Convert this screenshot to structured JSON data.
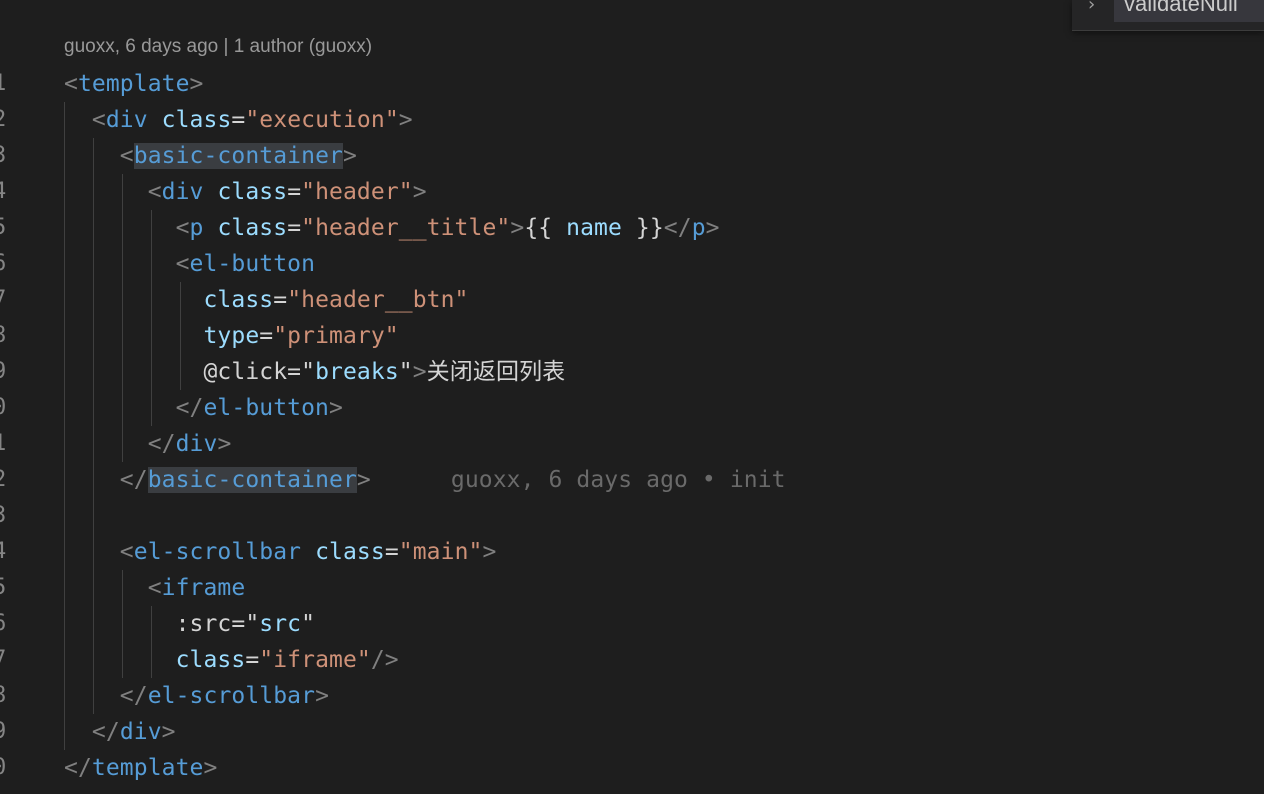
{
  "codelens": "guoxx, 6 days ago | 1 author (guoxx)",
  "peek": {
    "label": "validateNull"
  },
  "blame": {
    "text": "guoxx, 6 days ago • init"
  },
  "gutter": [
    "1",
    "2",
    "3",
    "4",
    "5",
    "6",
    "7",
    "8",
    "9",
    "0",
    "1",
    "2",
    "3",
    "4",
    "5",
    "6",
    "7",
    "8",
    "9",
    "0"
  ],
  "code": {
    "l1": [
      "<",
      "template",
      ">"
    ],
    "l2": [
      "<",
      "div",
      "class",
      "=",
      "\"execution\"",
      ">"
    ],
    "l3": [
      "<",
      "basic-container",
      ">"
    ],
    "l4": [
      "<",
      "div",
      "class",
      "=",
      "\"header\"",
      ">"
    ],
    "l5": [
      "<",
      "p",
      "class",
      "=",
      "\"header__title\"",
      ">",
      "{{ ",
      "name",
      " }}",
      "</",
      "p",
      ">"
    ],
    "l6": [
      "<",
      "el-button"
    ],
    "l7": [
      "class",
      "=",
      "\"header__btn\""
    ],
    "l8": [
      "type",
      "=",
      "\"primary\""
    ],
    "l9": [
      "@click",
      "=",
      "\"",
      "breaks",
      "\"",
      ">",
      "关闭返回列表"
    ],
    "l10": [
      "</",
      "el-button",
      ">"
    ],
    "l11": [
      "</",
      "div",
      ">"
    ],
    "l12": [
      "</",
      "basic-container",
      ">"
    ],
    "l14": [
      "<",
      "el-scrollbar",
      "class",
      "=",
      "\"main\"",
      ">"
    ],
    "l15": [
      "<",
      "iframe"
    ],
    "l16": [
      ":src",
      "=",
      "\"",
      "src",
      "\""
    ],
    "l17": [
      "class",
      "=",
      "\"iframe\"",
      "/>"
    ],
    "l18": [
      "</",
      "el-scrollbar",
      ">"
    ],
    "l19": [
      "</",
      "div",
      ">"
    ],
    "l20": [
      "</",
      "template",
      ">"
    ]
  }
}
